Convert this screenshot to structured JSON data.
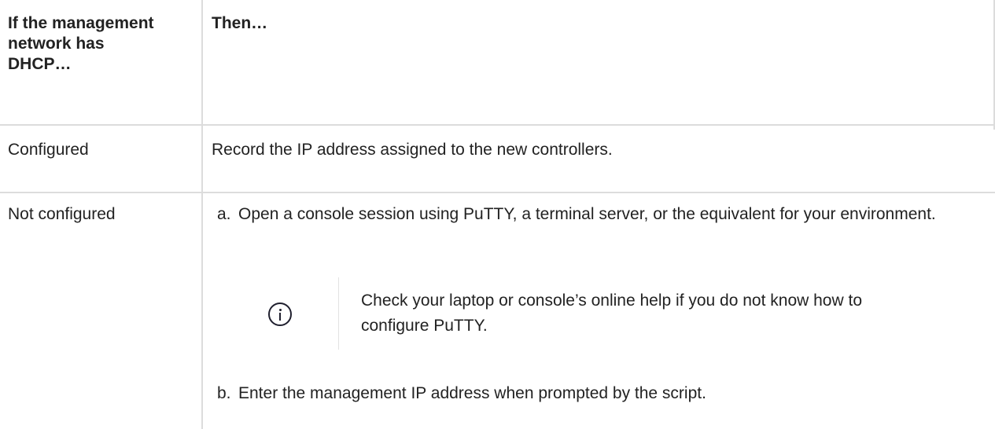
{
  "table": {
    "headers": {
      "col1": "If the management network has DHCP…",
      "col2": "Then…"
    },
    "rows": [
      {
        "condition": "Configured",
        "action": "Record the IP address assigned to the new controllers."
      },
      {
        "condition": "Not configured",
        "steps": [
          {
            "marker": "a.",
            "text": "Open a console session using PuTTY, a terminal server, or the equivalent for your environment."
          },
          {
            "marker": "b.",
            "text": "Enter the management IP address when prompted by the script."
          }
        ],
        "note": {
          "icon": "info-icon",
          "text": "Check your laptop or console’s online help if you do not know how to configure PuTTY."
        }
      }
    ]
  }
}
